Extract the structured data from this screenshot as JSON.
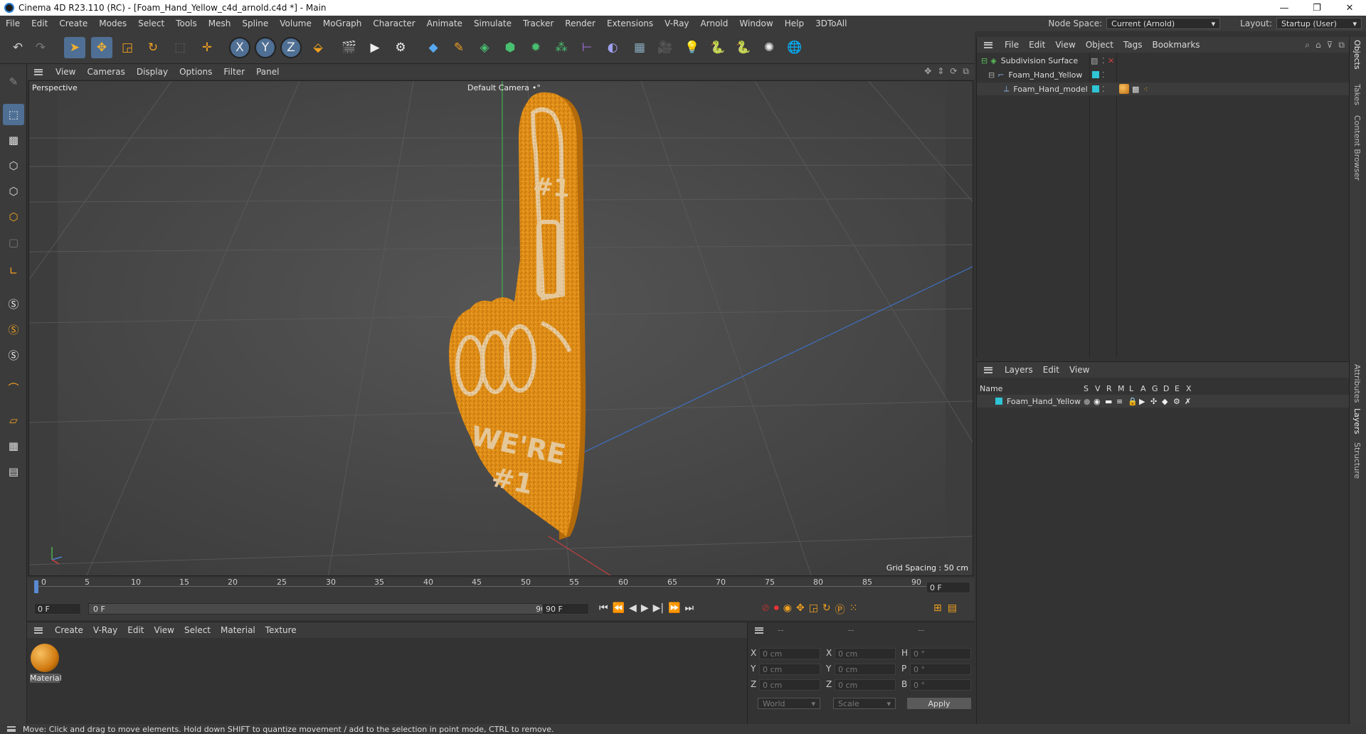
{
  "titlebar": {
    "title": "Cinema 4D R23.110 (RC) - [Foam_Hand_Yellow_c4d_arnold.c4d *] - Main",
    "min": "—",
    "max": "❐",
    "close": "✕"
  },
  "menu": {
    "items": [
      "File",
      "Edit",
      "Create",
      "Modes",
      "Select",
      "Tools",
      "Mesh",
      "Spline",
      "Volume",
      "MoGraph",
      "Character",
      "Animate",
      "Simulate",
      "Tracker",
      "Render",
      "Extensions",
      "V-Ray",
      "Arnold",
      "Window",
      "Help",
      "3DToAll"
    ],
    "node_space_label": "Node Space:",
    "node_space_value": "Current (Arnold)",
    "layout_label": "Layout:",
    "layout_value": "Startup (User)"
  },
  "viewport": {
    "menu": [
      "View",
      "Cameras",
      "Display",
      "Options",
      "Filter",
      "Panel"
    ],
    "label": "Perspective",
    "camera": "Default Camera",
    "camera_icon": "•°",
    "grid_spacing": "Grid Spacing : 50 cm",
    "model_text_number": "#1",
    "model_text_were": "WE'RE",
    "model_text_no": "#1"
  },
  "timeline": {
    "ticks": [
      "0",
      "5",
      "10",
      "15",
      "20",
      "25",
      "30",
      "35",
      "40",
      "45",
      "50",
      "55",
      "60",
      "65",
      "70",
      "75",
      "80",
      "85",
      "90"
    ],
    "current_frame": "0 F",
    "start_field": "0 F",
    "range_start": "0 F",
    "range_end": "90 F",
    "end_field": "90 F"
  },
  "materials": {
    "menu": [
      "Create",
      "V-Ray",
      "Edit",
      "View",
      "Select",
      "Material",
      "Texture"
    ],
    "items": [
      {
        "name": "Material"
      }
    ]
  },
  "coords": {
    "header": [
      "--",
      "--",
      "--"
    ],
    "rows": [
      {
        "a": "X",
        "av": "0 cm",
        "b": "X",
        "bv": "0 cm",
        "c": "H",
        "cv": "0 °"
      },
      {
        "a": "Y",
        "av": "0 cm",
        "b": "Y",
        "bv": "0 cm",
        "c": "P",
        "cv": "0 °"
      },
      {
        "a": "Z",
        "av": "0 cm",
        "b": "Z",
        "bv": "0 cm",
        "c": "B",
        "cv": "0 °"
      }
    ],
    "world": "World",
    "scale": "Scale",
    "apply": "Apply"
  },
  "objects": {
    "menu": [
      "File",
      "Edit",
      "View",
      "Object",
      "Tags",
      "Bookmarks"
    ],
    "rows": [
      {
        "name": "Subdivision Surface"
      },
      {
        "name": "Foam_Hand_Yellow"
      },
      {
        "name": "Foam_Hand_model"
      }
    ]
  },
  "layers": {
    "menu": [
      "Layers",
      "Edit",
      "View"
    ],
    "col_name": "Name",
    "cols": [
      "S",
      "V",
      "R",
      "M",
      "L",
      "A",
      "G",
      "D",
      "E",
      "X"
    ],
    "rows": [
      {
        "name": "Foam_Hand_Yellow"
      }
    ]
  },
  "rightrail": [
    "Objects",
    "Takes",
    "Content Browser",
    "Attributes",
    "Layers",
    "Structure"
  ],
  "status": "Move: Click and drag to move elements. Hold down SHIFT to quantize movement / add to the selection in point mode, CTRL to remove.",
  "colors": {
    "accent": "#4a90d9",
    "foam": "#e8951a",
    "layer_color": "#2fc4d6"
  }
}
